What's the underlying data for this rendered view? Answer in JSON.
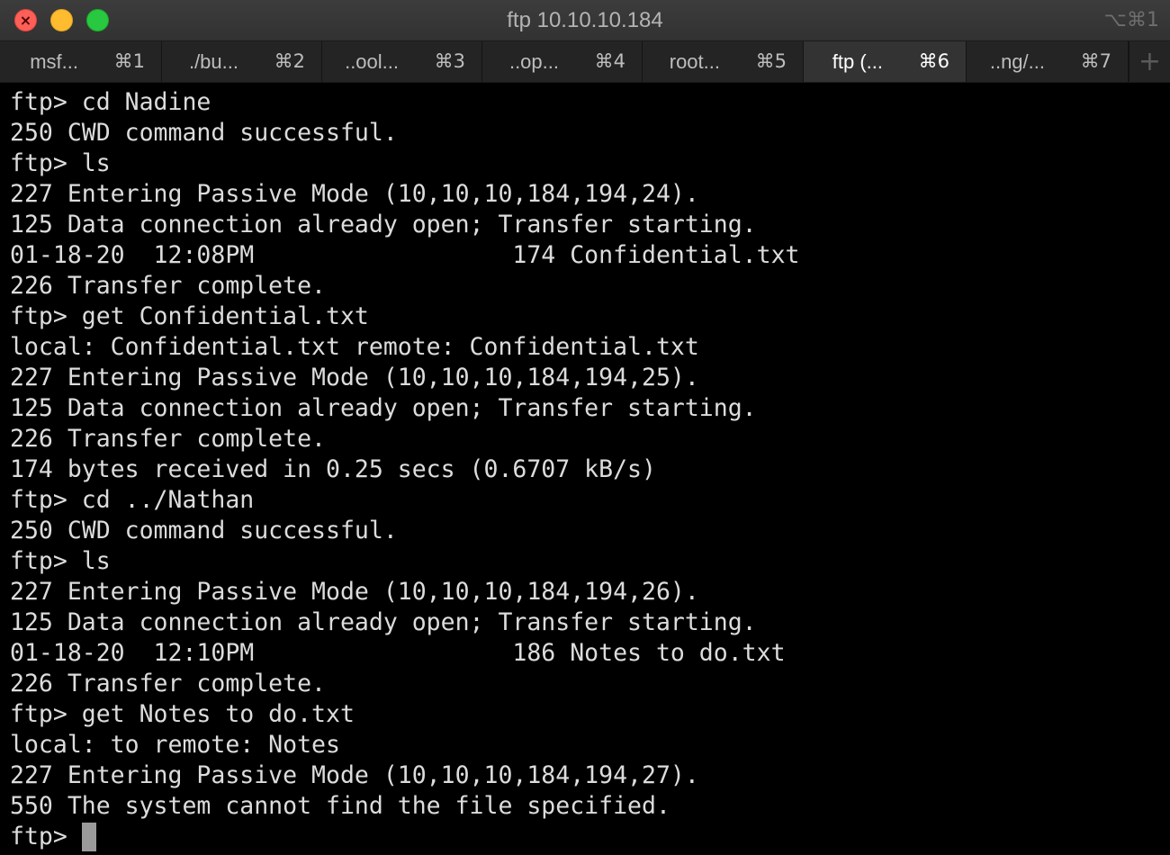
{
  "window": {
    "title": "ftp 10.10.10.184",
    "shortcut": "⌥⌘1"
  },
  "tabs": [
    {
      "label": "msf...",
      "key": "⌘1",
      "active": false
    },
    {
      "label": "./bu...",
      "key": "⌘2",
      "active": false
    },
    {
      "label": "..ool...",
      "key": "⌘3",
      "active": false
    },
    {
      "label": "..op...",
      "key": "⌘4",
      "active": false
    },
    {
      "label": "root...",
      "key": "⌘5",
      "active": false
    },
    {
      "label": "ftp (...",
      "key": "⌘6",
      "active": true
    },
    {
      "label": "..ng/...",
      "key": "⌘7",
      "active": false
    }
  ],
  "new_tab_icon": "+",
  "terminal": {
    "lines": [
      "ftp> cd Nadine",
      "250 CWD command successful.",
      "ftp> ls",
      "227 Entering Passive Mode (10,10,10,184,194,24).",
      "125 Data connection already open; Transfer starting.",
      "01-18-20  12:08PM                  174 Confidential.txt",
      "226 Transfer complete.",
      "ftp> get Confidential.txt",
      "local: Confidential.txt remote: Confidential.txt",
      "227 Entering Passive Mode (10,10,10,184,194,25).",
      "125 Data connection already open; Transfer starting.",
      "226 Transfer complete.",
      "174 bytes received in 0.25 secs (0.6707 kB/s)",
      "ftp> cd ../Nathan",
      "250 CWD command successful.",
      "ftp> ls",
      "227 Entering Passive Mode (10,10,10,184,194,26).",
      "125 Data connection already open; Transfer starting.",
      "01-18-20  12:10PM                  186 Notes to do.txt",
      "226 Transfer complete.",
      "ftp> get Notes to do.txt",
      "local: to remote: Notes",
      "227 Entering Passive Mode (10,10,10,184,194,27).",
      "550 The system cannot find the file specified."
    ],
    "prompt": "ftp> "
  },
  "colors": {
    "background": "#000000",
    "text": "#dcdcdc",
    "cursor": "#9a9a9a",
    "close": "#fe5f57",
    "minimize": "#febc2e",
    "maximize": "#28c840"
  }
}
